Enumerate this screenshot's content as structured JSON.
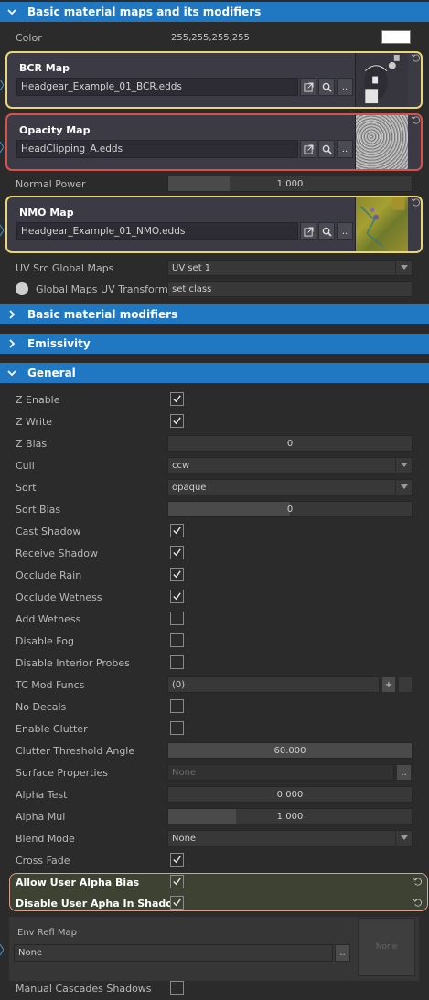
{
  "sections": {
    "basic_maps": "Basic material maps and its modifiers",
    "basic_modifiers": "Basic material modifiers",
    "emissivity": "Emissivity",
    "general": "General"
  },
  "color": {
    "label": "Color",
    "value": "255,255,255,255",
    "swatch": "#ffffff"
  },
  "maps": {
    "bcr": {
      "title": "BCR Map",
      "file": "Headgear_Example_01_BCR.edds",
      "border": "#e8d678"
    },
    "opacity": {
      "title": "Opacity Map",
      "file": "HeadClipping_A.edds",
      "border": "#d8524c"
    },
    "nmo": {
      "title": "NMO Map",
      "file": "Headgear_Example_01_NMO.edds",
      "border": "#e8d678"
    }
  },
  "map_buttons": {
    "more": ".."
  },
  "normal_power": {
    "label": "Normal Power",
    "value": "1.000",
    "fraction": 0.25
  },
  "uv_src": {
    "label": "UV Src Global Maps",
    "value": "UV set 1"
  },
  "global_uv": {
    "label": "Global Maps UV Transform",
    "value": "set class"
  },
  "general": {
    "z_enable": {
      "label": "Z Enable",
      "checked": true
    },
    "z_write": {
      "label": "Z Write",
      "checked": true
    },
    "z_bias": {
      "label": "Z Bias",
      "value": "0"
    },
    "cull": {
      "label": "Cull",
      "value": "ccw"
    },
    "sort": {
      "label": "Sort",
      "value": "opaque"
    },
    "sort_bias": {
      "label": "Sort Bias",
      "value": "0"
    },
    "cast_shadow": {
      "label": "Cast Shadow",
      "checked": true
    },
    "receive_shadow": {
      "label": "Receive Shadow",
      "checked": true
    },
    "occlude_rain": {
      "label": "Occlude Rain",
      "checked": true
    },
    "occlude_wetness": {
      "label": "Occlude Wetness",
      "checked": true
    },
    "add_wetness": {
      "label": "Add Wetness",
      "checked": false
    },
    "disable_fog": {
      "label": "Disable Fog",
      "checked": false
    },
    "disable_interior_probes": {
      "label": "Disable Interior Probes",
      "checked": false
    },
    "tc_mod_funcs": {
      "label": "TC Mod Funcs",
      "value": "(0)",
      "add": "+"
    },
    "no_decals": {
      "label": "No Decals",
      "checked": false
    },
    "enable_clutter": {
      "label": "Enable Clutter",
      "checked": false
    },
    "clutter_threshold": {
      "label": "Clutter Threshold Angle",
      "value": "60.000"
    },
    "surface_properties": {
      "label": "Surface Properties",
      "value": "None",
      "more": ".."
    },
    "alpha_test": {
      "label": "Alpha Test",
      "value": "0.000"
    },
    "alpha_mul": {
      "label": "Alpha Mul",
      "value": "1.000",
      "fraction": 0.28
    },
    "blend_mode": {
      "label": "Blend Mode",
      "value": "None"
    },
    "cross_fade": {
      "label": "Cross Fade",
      "checked": true
    },
    "allow_user_alpha_bias": {
      "label": "Allow User Alpha Bias",
      "checked": true
    },
    "disable_user_alpha_shadow": {
      "label": "Disable User Apha In Shadow",
      "checked": true
    },
    "env_refl_map": {
      "label": "Env Refl Map",
      "value": "None",
      "more": "..",
      "thumb": "None"
    },
    "manual_cascades": {
      "label": "Manual Cascades Shadows",
      "checked": false
    }
  },
  "colors": {
    "accent": "#1f78c1",
    "panel": "#2b2b2b",
    "highlight_border": "#d8a090"
  }
}
